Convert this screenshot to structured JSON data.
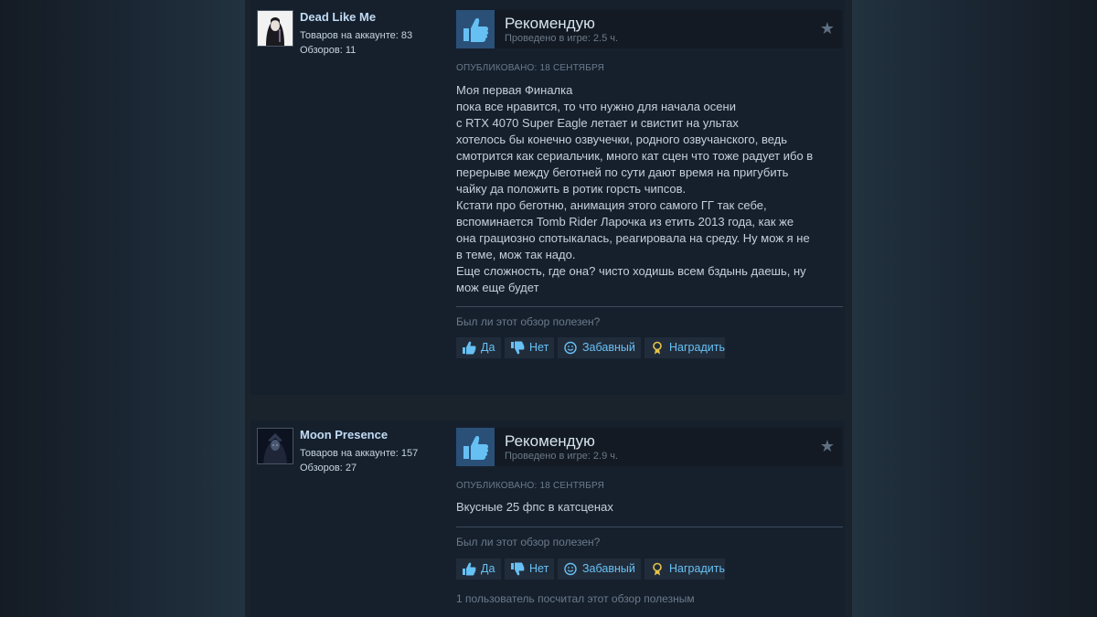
{
  "reviews": [
    {
      "user": {
        "name": "Dead Like Me",
        "products": "Товаров на аккаунте: 83",
        "reviews": "Обзоров: 11"
      },
      "verdict": "Рекомендую",
      "hours": "Проведено в игре: 2.5 ч.",
      "posted": "Опубликовано: 18 сентября",
      "body": [
        "Моя первая Финалка",
        "пока все нравится, то что нужно для начала осени",
        "с RTX 4070 Super Eagle летает и свистит на ультах",
        "хотелось бы конечно озвучечки, родного озвучанского, ведь",
        "смотрится как сериальчик, много кат сцен что тоже радует ибо в",
        "перерыве между беготней по сути дают время на пригубить",
        "чайку да положить в ротик горсть чипсов.",
        "Кстати про беготню, анимация этого самого ГГ так себе,",
        "вспоминается Tomb Rider Ларочка из етить 2013 года, как же",
        "она грациозно спотыкалась, реагировала на среду. Ну мож я не",
        "в теме, мож так надо.",
        "Еще сложность, где она? чисто ходишь всем бздынь даешь, ну",
        "мож еще будет"
      ],
      "helpful_question": "Был ли этот обзор полезен?",
      "buttons": {
        "yes": "Да",
        "no": "Нет",
        "funny": "Забавный",
        "award": "Наградить"
      }
    },
    {
      "user": {
        "name": "Moon Presence",
        "products": "Товаров на аккаунте: 157",
        "reviews": "Обзоров: 27"
      },
      "verdict": "Рекомендую",
      "hours": "Проведено в игре: 2.9 ч.",
      "posted": "Опубликовано: 18 сентября",
      "body": [
        "Вкусные 25 фпс в катсценах"
      ],
      "helpful_question": "Был ли этот обзор полезен?",
      "buttons": {
        "yes": "Да",
        "no": "Нет",
        "funny": "Забавный",
        "award": "Наградить"
      },
      "helpful_count": "1 пользователь посчитал этот обзор полезным"
    }
  ],
  "colors": {
    "accent_link": "#67c1f5",
    "username": "#c1dbf4",
    "thumb_bg": "#2a5078",
    "award": "#e6c44a"
  },
  "icons": {
    "recommend": "thumbs-up-icon",
    "favorite": "star-icon",
    "vote_yes": "thumbs-up-icon",
    "vote_no": "thumbs-down-icon",
    "funny": "smiley-icon",
    "award": "award-icon"
  }
}
